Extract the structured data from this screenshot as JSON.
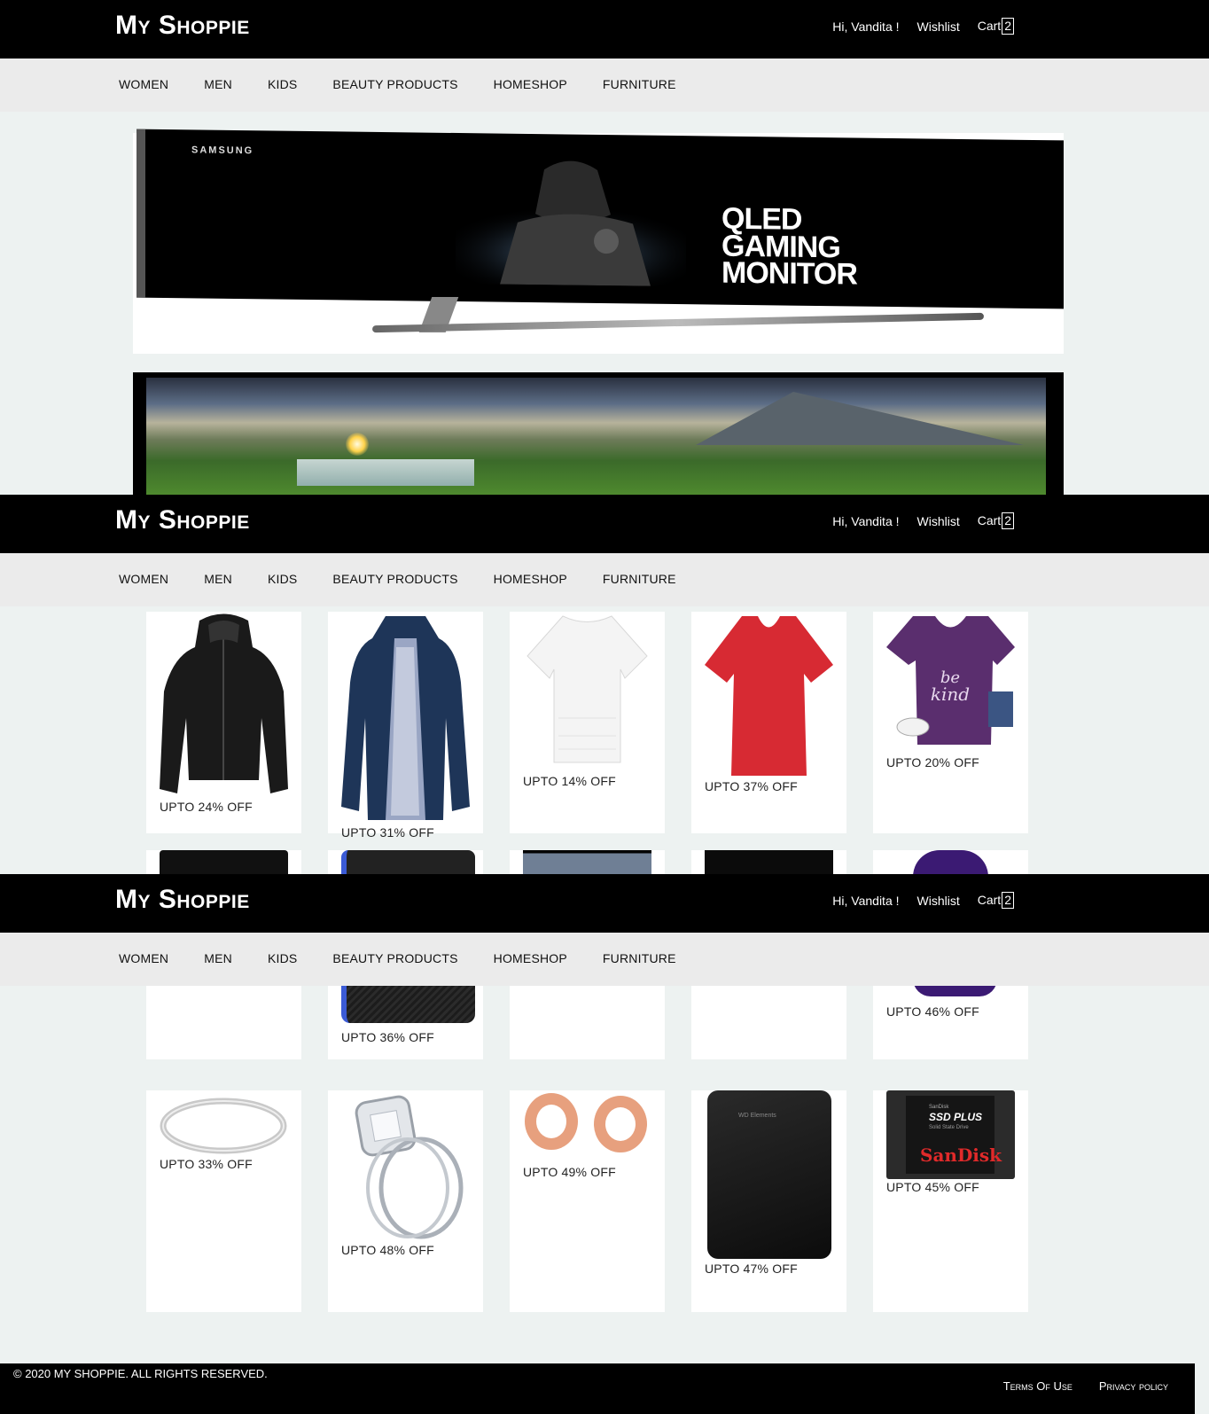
{
  "brand": {
    "name": "My Shoppie"
  },
  "user_nav": {
    "greeting": "Hi, Vandita !",
    "wishlist": "Wishlist",
    "cart": "Cart",
    "cart_count": "2"
  },
  "menu": {
    "items": [
      "WOMEN",
      "MEN",
      "KIDS",
      "BEAUTY PRODUCTS",
      "HOMESHOP",
      "FURNITURE"
    ]
  },
  "banners": {
    "monitor": {
      "brand": "SAMSUNG",
      "headline_1": "QLED",
      "headline_2": "GAMING",
      "headline_3": "MONITOR"
    }
  },
  "products_row1": [
    {
      "discount": "UPTO 24% OFF",
      "icon": "black-leather-jacket"
    },
    {
      "discount": "UPTO 31% OFF",
      "icon": "navy-raincoat"
    },
    {
      "discount": "UPTO 14% OFF",
      "icon": "white-top"
    },
    {
      "discount": "UPTO 37% OFF",
      "icon": "red-tshirt"
    },
    {
      "discount": "UPTO 20% OFF",
      "icon": "purple-tshirt"
    }
  ],
  "products_row2": [
    {
      "discount": "",
      "icon": "dark-laptop"
    },
    {
      "discount": "UPTO 36% OFF",
      "icon": "phone-case"
    },
    {
      "discount": "",
      "icon": "monitor"
    },
    {
      "discount": "",
      "icon": "curved-monitor"
    },
    {
      "discount": "UPTO 46% OFF",
      "icon": "purple-hoodie"
    }
  ],
  "products_row3": [
    {
      "discount": "UPTO 33% OFF",
      "icon": "silver-ring"
    },
    {
      "discount": "UPTO 48% OFF",
      "icon": "diamond-ring"
    },
    {
      "discount": "UPTO 49% OFF",
      "icon": "ear-plugs"
    },
    {
      "discount": "UPTO 47% OFF",
      "icon": "external-hard-drive"
    },
    {
      "discount": "UPTO 45% OFF",
      "icon": "sandisk-ssd"
    }
  ],
  "ssd_label": {
    "small": "SanDisk",
    "title": "SSD PLUS",
    "sub": "Solid State Drive",
    "brand": "SanDisk"
  },
  "hdd_label": "WD Elements",
  "footer": {
    "copyright": "© 2020 MY SHOPPIE. ALL RIGHTS RESERVED.",
    "terms": "Terms Of Use",
    "privacy": "Privacy policy"
  }
}
